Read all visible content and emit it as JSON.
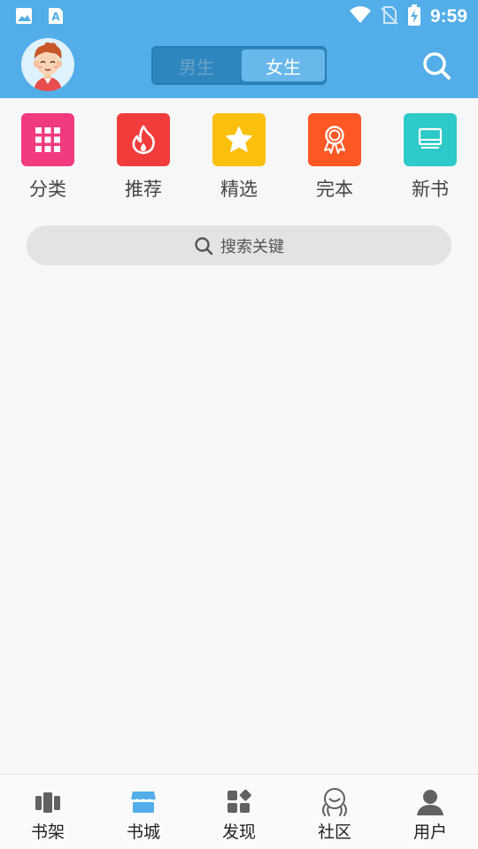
{
  "status_bar": {
    "time": "9:59",
    "icons": [
      "image-icon",
      "text-a-icon",
      "wifi-icon",
      "no-sim-icon",
      "battery-charging-icon"
    ]
  },
  "header": {
    "avatar_icon": "cartoon-boy-avatar",
    "gender_toggle": {
      "options": [
        "男生",
        "女生"
      ],
      "selected": "女生"
    },
    "search_icon": "search-icon"
  },
  "categories": [
    {
      "label": "分类",
      "icon": "grid-icon",
      "color": "#f23a80"
    },
    {
      "label": "推荐",
      "icon": "flame-icon",
      "color": "#f23c3c"
    },
    {
      "label": "精选",
      "icon": "star-icon",
      "color": "#fbbf0e"
    },
    {
      "label": "完本",
      "icon": "award-icon",
      "color": "#fd5724"
    },
    {
      "label": "新书",
      "icon": "book-icon",
      "color": "#2ec9c9"
    }
  ],
  "search": {
    "placeholder": "搜索关键"
  },
  "bottom_nav": {
    "tabs": [
      {
        "label": "书架",
        "icon": "bookshelf-icon"
      },
      {
        "label": "书城",
        "icon": "bookstore-icon",
        "active": true
      },
      {
        "label": "发现",
        "icon": "discover-icon"
      },
      {
        "label": "社区",
        "icon": "community-icon"
      },
      {
        "label": "用户",
        "icon": "user-icon"
      }
    ]
  },
  "colors": {
    "primary": "#52ade8",
    "active_tab": "#52ade8",
    "inactive_tab": "#616161"
  }
}
